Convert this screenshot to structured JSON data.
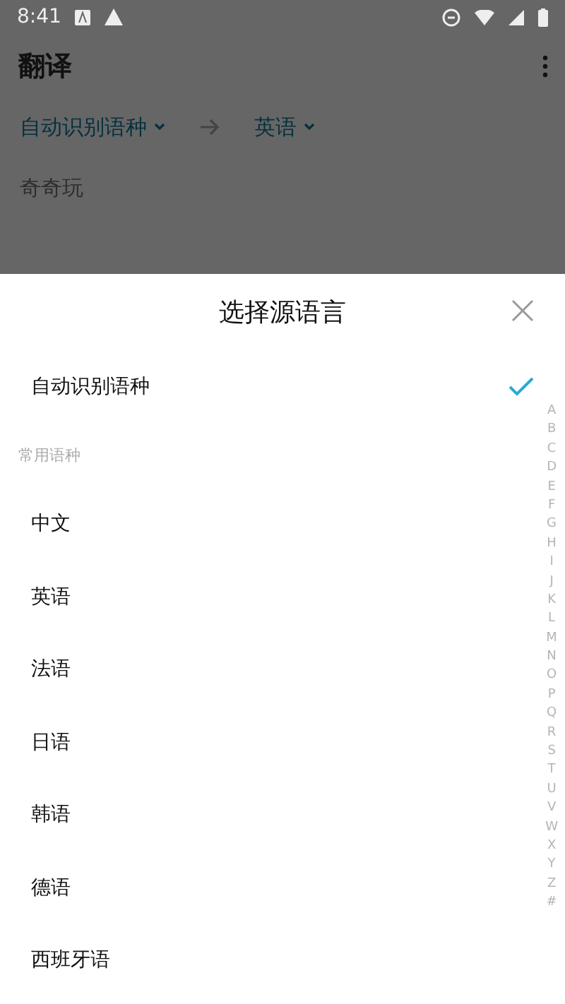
{
  "status_bar": {
    "time": "8:41"
  },
  "app_bar": {
    "title": "翻译"
  },
  "language_row": {
    "source": "自动识别语种",
    "target": "英语"
  },
  "input": {
    "placeholder": "奇奇玩"
  },
  "sheet": {
    "title": "选择源语言",
    "auto_item": {
      "label": "自动识别语种",
      "selected": true
    },
    "section": "常用语种",
    "items": [
      {
        "label": "中文",
        "selected": false
      },
      {
        "label": "英语",
        "selected": false
      },
      {
        "label": "法语",
        "selected": false
      },
      {
        "label": "日语",
        "selected": false
      },
      {
        "label": "韩语",
        "selected": false
      },
      {
        "label": "德语",
        "selected": false
      },
      {
        "label": "西班牙语",
        "selected": false
      }
    ],
    "index": [
      "A",
      "B",
      "C",
      "D",
      "E",
      "F",
      "G",
      "H",
      "I",
      "J",
      "K",
      "L",
      "M",
      "N",
      "O",
      "P",
      "Q",
      "R",
      "S",
      "T",
      "U",
      "V",
      "W",
      "X",
      "Y",
      "Z",
      "#"
    ]
  }
}
